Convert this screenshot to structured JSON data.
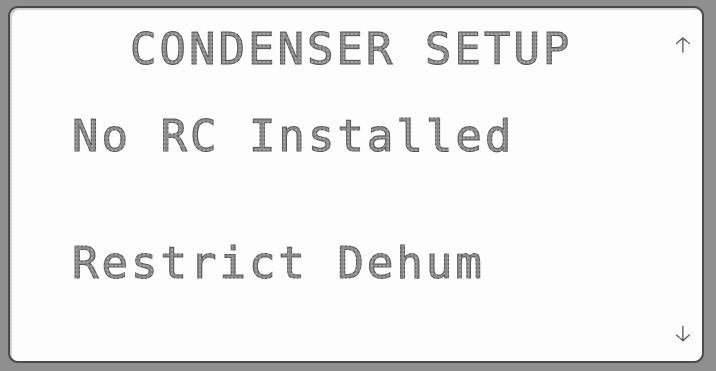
{
  "screen": {
    "title": "CONDENSER SETUP",
    "lines": [
      "No RC Installed",
      "Restrict Dehum"
    ],
    "scroll_up_icon": "arrow-up-icon",
    "scroll_down_icon": "arrow-down-icon"
  },
  "colors": {
    "background": "#fdfdfd",
    "text": "#8a8a8a",
    "frame": "#4a4a4a"
  }
}
